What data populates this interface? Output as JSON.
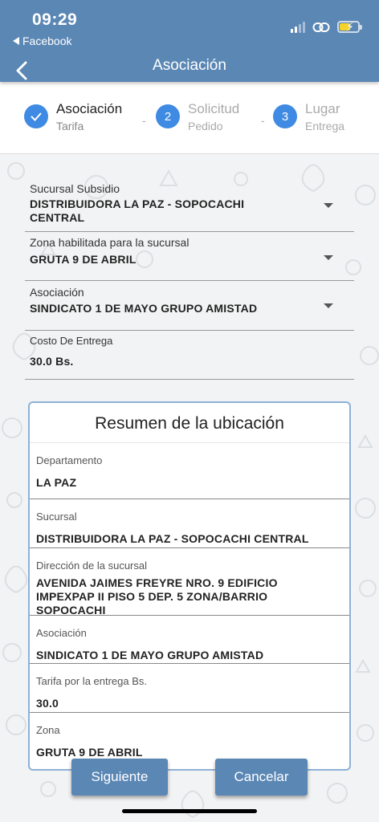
{
  "status_bar": {
    "time": "09:29",
    "back_app": "Facebook",
    "icons": [
      "signal-icon",
      "link-icon",
      "battery-charging-icon"
    ]
  },
  "header": {
    "title": "Asociación"
  },
  "stepper": {
    "steps": [
      {
        "number": "",
        "title": "Asociación",
        "subtitle": "Tarifa",
        "state": "done"
      },
      {
        "number": "2",
        "title": "Solicitud",
        "subtitle": "Pedido",
        "state": "pending"
      },
      {
        "number": "3",
        "title": "Lugar",
        "subtitle": "Entrega",
        "state": "pending"
      }
    ],
    "separator": "-"
  },
  "form": {
    "sucursal": {
      "label": "Sucursal Subsidio",
      "value": "DISTRIBUIDORA LA PAZ - SOPOCACHI CENTRAL"
    },
    "zona": {
      "label": "Zona habilitada para la sucursal",
      "value": "GRUTA 9 DE ABRIL"
    },
    "asociacion": {
      "label": "Asociación",
      "value": "SINDICATO 1 DE MAYO GRUPO AMISTAD"
    },
    "costo": {
      "label": "Costo De Entrega",
      "value": "30.0 Bs."
    }
  },
  "summary": {
    "title": "Resumen de la ubicación",
    "rows": [
      {
        "key": "Departamento",
        "value": "LA PAZ"
      },
      {
        "key": "Sucursal",
        "value": "DISTRIBUIDORA LA PAZ - SOPOCACHI CENTRAL"
      },
      {
        "key": "Dirección de la sucursal",
        "value": "AVENIDA JAIMES FREYRE NRO. 9 EDIFICIO IMPEXPAP II PISO 5 DEP. 5 ZONA/BARRIO SOPOCACHI"
      },
      {
        "key": "Asociación",
        "value": "SINDICATO 1 DE MAYO GRUPO AMISTAD"
      },
      {
        "key": "Tarifa por la entrega Bs.",
        "value": "30.0"
      },
      {
        "key": "Zona",
        "value": "GRUTA 9 DE ABRIL"
      }
    ]
  },
  "buttons": {
    "next": "Siguiente",
    "cancel": "Cancelar"
  },
  "colors": {
    "primary": "#5b87b5",
    "step_active": "#3f8ae2",
    "background": "#f2f3f4"
  }
}
